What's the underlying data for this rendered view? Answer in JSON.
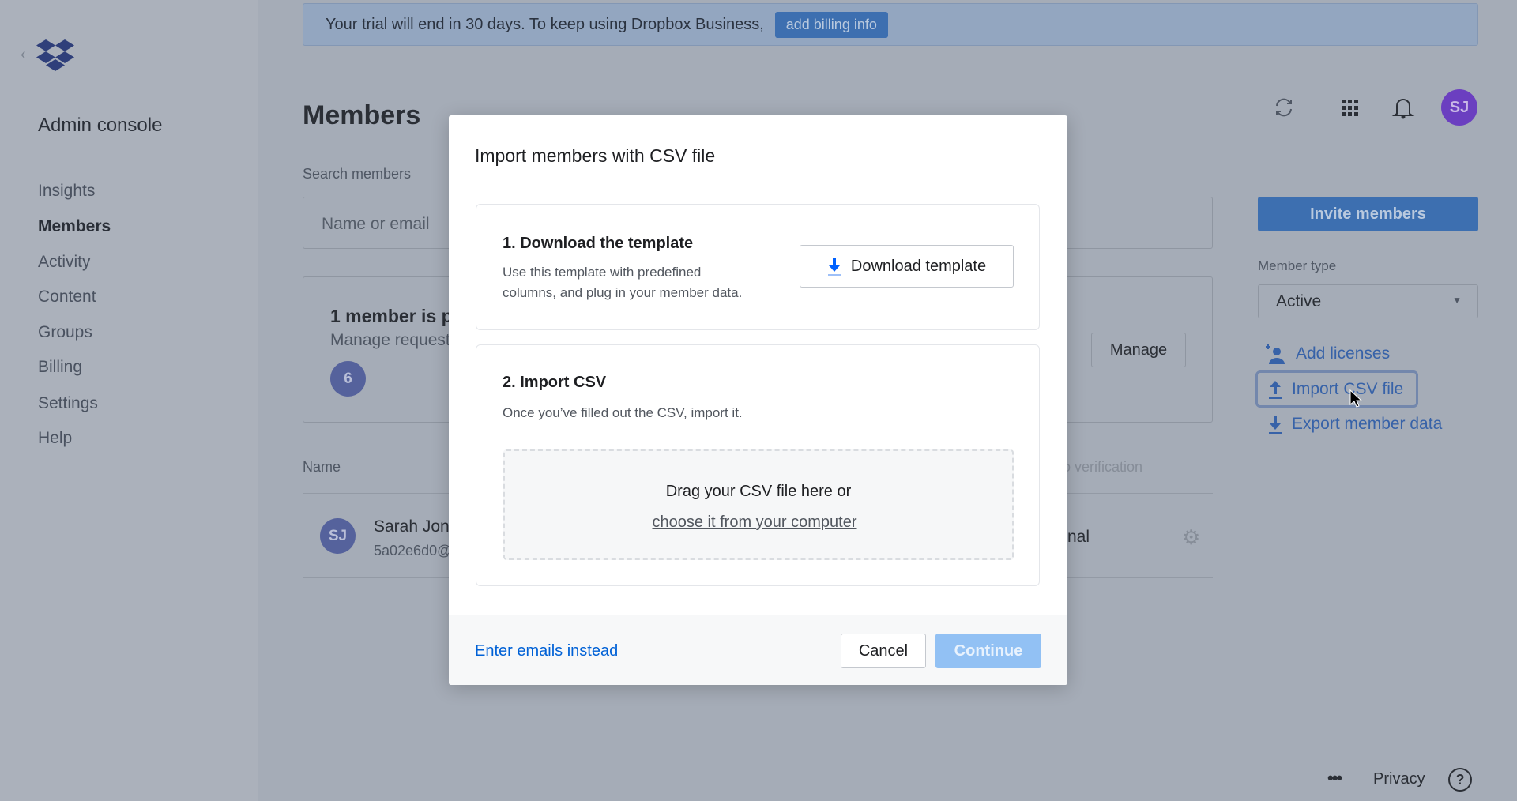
{
  "sidebar": {
    "title": "Admin console",
    "items": [
      {
        "label": "Insights"
      },
      {
        "label": "Members",
        "active": true
      },
      {
        "label": "Activity"
      },
      {
        "label": "Content"
      },
      {
        "label": "Groups"
      },
      {
        "label": "Billing"
      },
      {
        "label": "Settings"
      },
      {
        "label": "Help"
      }
    ]
  },
  "banner": {
    "text": "Your trial will end in 30 days. To keep using Dropbox Business,",
    "button": "add billing info"
  },
  "header": {
    "title": "Members",
    "avatar": "SJ",
    "icons": [
      "refresh-icon",
      "apps-grid-icon",
      "bell-icon"
    ]
  },
  "search": {
    "label": "Search members",
    "placeholder": "Name or email"
  },
  "pending": {
    "title": "1 member is p",
    "subtitle": "Manage request",
    "badge": "6",
    "manage": "Manage"
  },
  "table": {
    "col_name": "Name",
    "col_verification": "o verification",
    "rows": [
      {
        "initials": "SJ",
        "name": "Sarah Jona",
        "email": "5a02e6d0@",
        "type": "nal"
      }
    ]
  },
  "right": {
    "invite": "Invite members",
    "member_type_label": "Member type",
    "member_type_value": "Active",
    "actions": [
      {
        "label": "Add licenses",
        "icon": "add-user-icon"
      },
      {
        "label": "Import CSV file",
        "icon": "upload-icon"
      },
      {
        "label": "Export member data",
        "icon": "download-icon"
      }
    ]
  },
  "footer": {
    "privacy": "Privacy"
  },
  "modal": {
    "title": "Import members with CSV file",
    "step1": {
      "heading": "1. Download the template",
      "desc1": "Use this template with predefined",
      "desc2": "columns, and plug in your member data.",
      "button": "Download template"
    },
    "step2": {
      "heading": "2. Import CSV",
      "desc": "Once you’ve filled out the CSV, import it.",
      "drop": "Drag your CSV file here or",
      "choose": "choose it from your computer"
    },
    "enter_emails": "Enter emails instead",
    "cancel": "Cancel",
    "continue": "Continue"
  },
  "colors": {
    "accent": "#0061fe",
    "overlay": "#a5acb7",
    "avatar": "#6b3fc0",
    "continue_disabled": "#92c1f4"
  }
}
